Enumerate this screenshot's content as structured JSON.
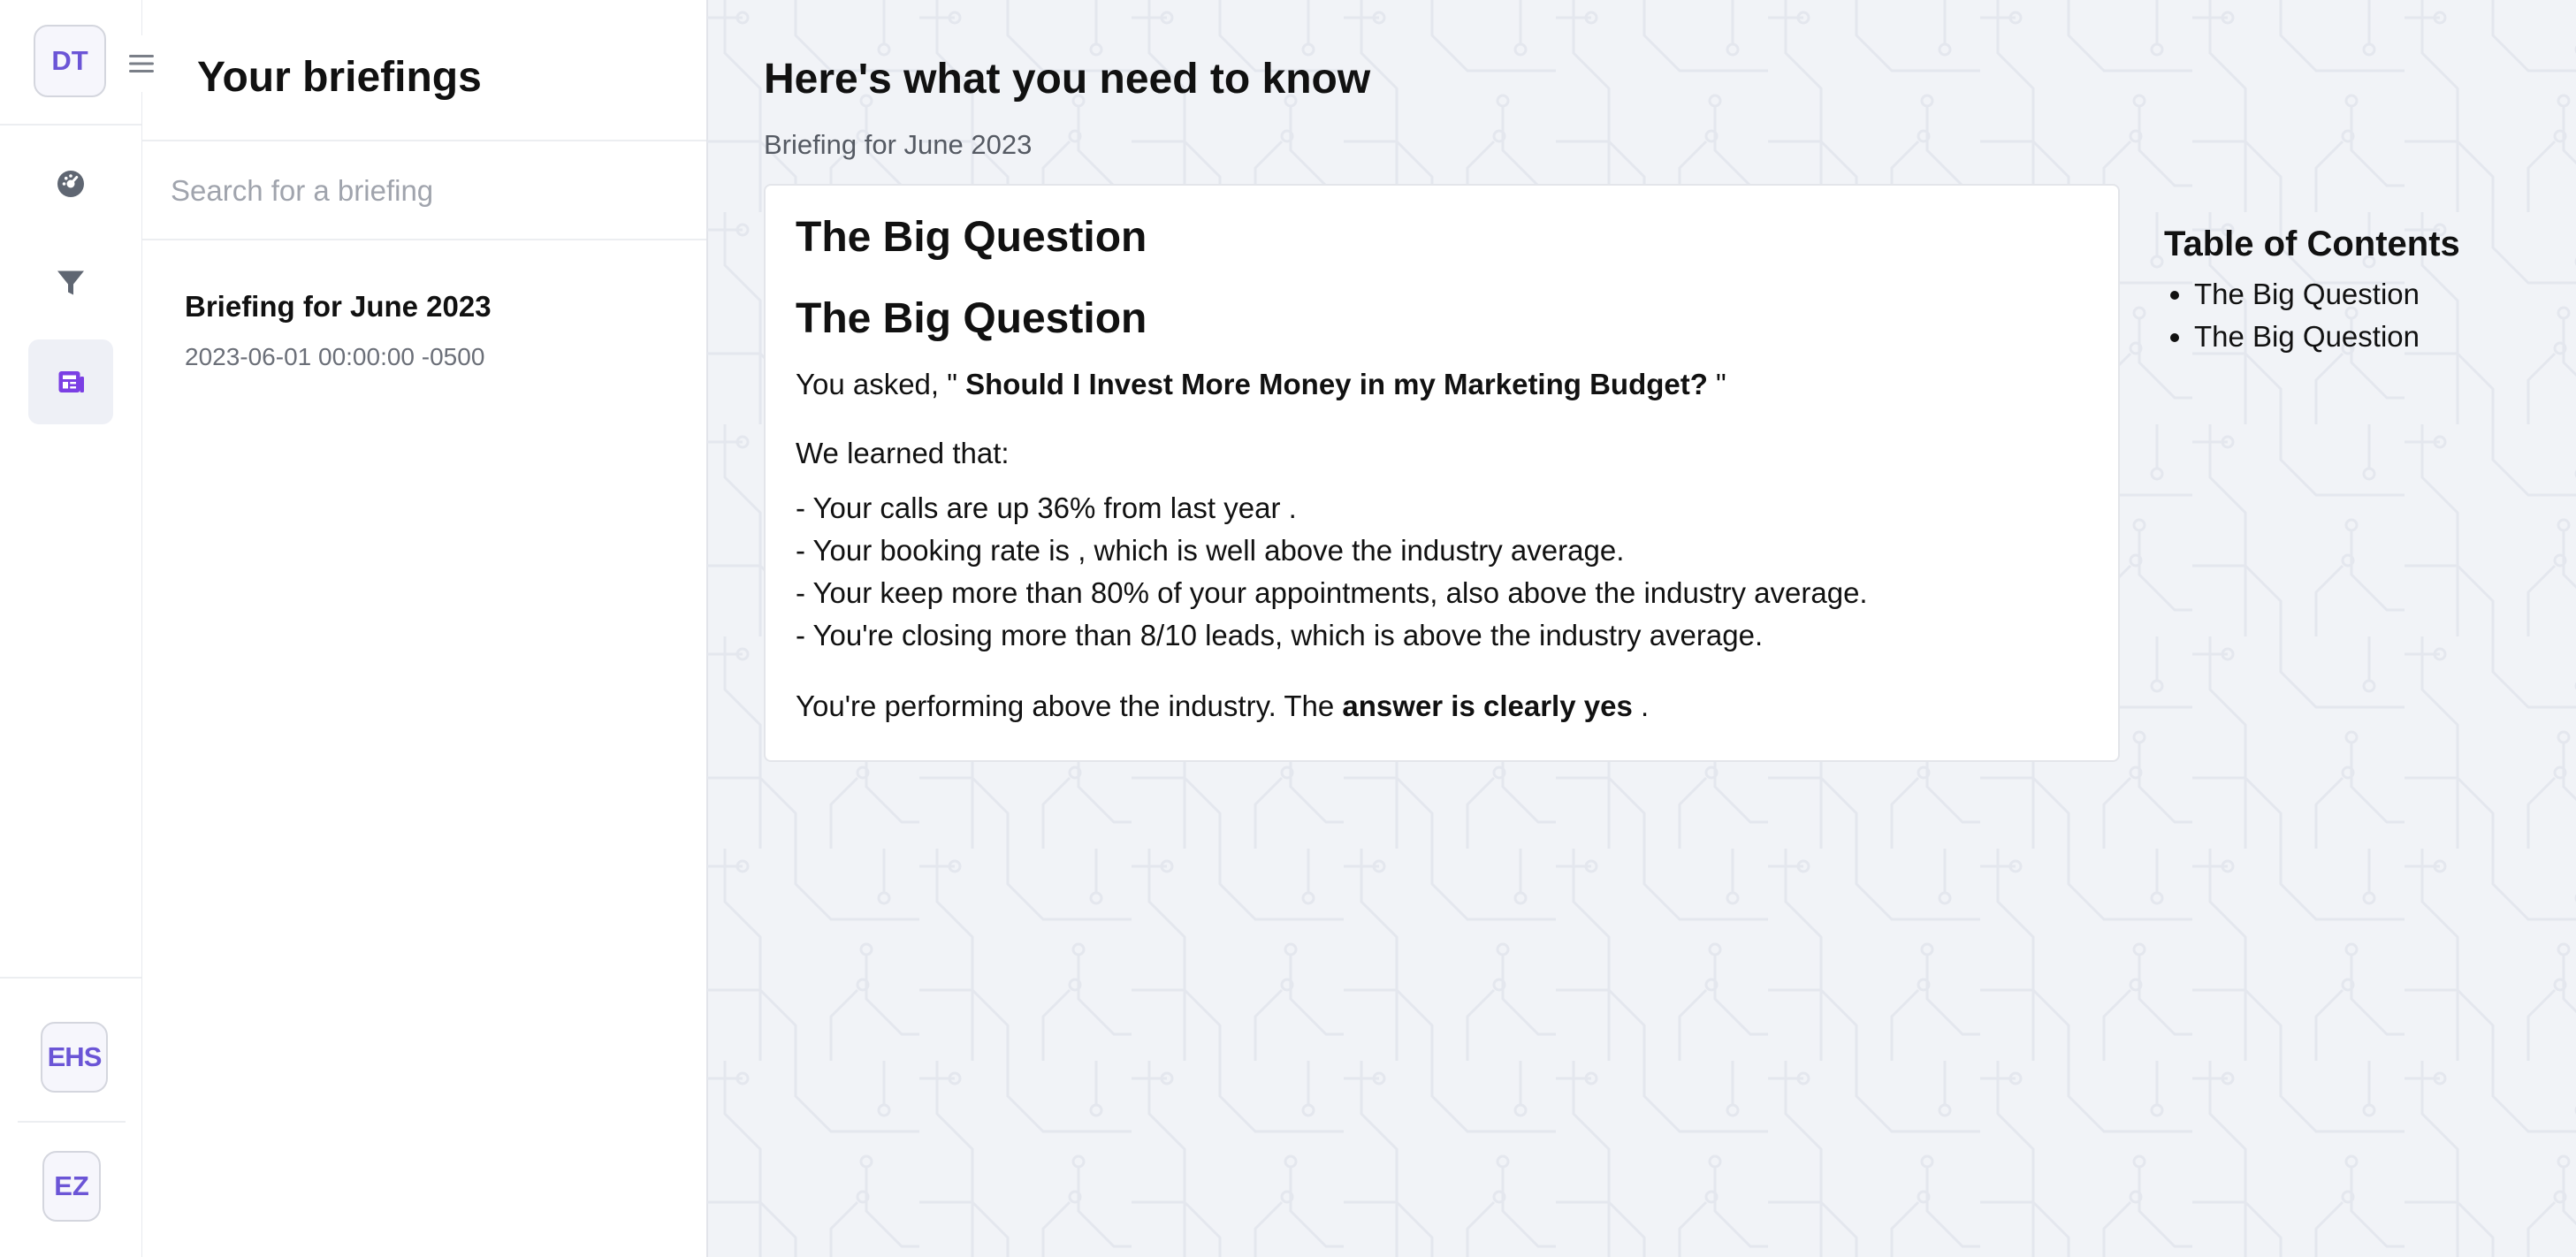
{
  "rail": {
    "user_initials": "DT",
    "bottom_avatars": [
      "EHS",
      "EZ"
    ],
    "nav_icons": [
      "dashboard-icon",
      "filter-icon",
      "newspaper-icon"
    ],
    "accent_color": "#7b3fe4"
  },
  "panel": {
    "title": "Your briefings",
    "search_placeholder": "Search for a briefing",
    "items": [
      {
        "title": "Briefing for June 2023",
        "date": "2023-06-01 00:00:00 -0500"
      }
    ]
  },
  "main": {
    "title": "Here's what you need to know",
    "subtitle": "Briefing for June 2023",
    "card": {
      "heading1": "The Big Question",
      "heading2": "The Big Question",
      "asked_prefix": "You asked, \" ",
      "asked_question": "Should I Invest More Money in my Marketing Budget?",
      "asked_suffix": " \"",
      "learned": "We learned that:",
      "facts": [
        "- Your calls are up 36% from last year .",
        "- Your booking rate is , which is well above the industry average.",
        "- Your keep more than 80% of your appointments, also above the industry average.",
        "- You're closing more than 8/10 leads, which is above the industry average."
      ],
      "conclusion_prefix": "You're performing above the industry. The ",
      "conclusion_bold": "answer is clearly yes",
      "conclusion_suffix": " ."
    },
    "toc": {
      "title": "Table of Contents",
      "items": [
        "The Big Question",
        "The Big Question"
      ]
    }
  }
}
